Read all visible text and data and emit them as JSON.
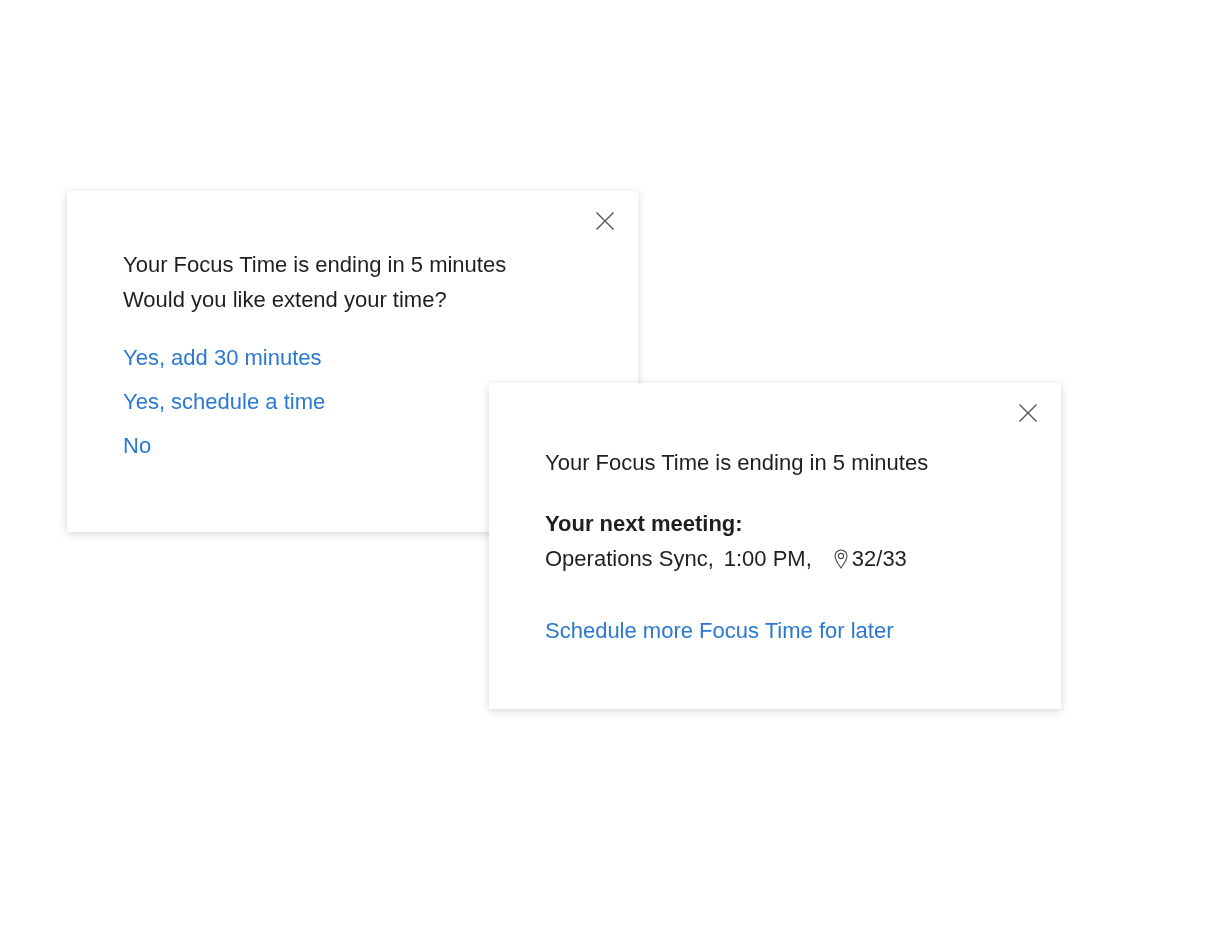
{
  "extend_prompt": {
    "message_lines": [
      "Your Focus Time is ending in 5 minutes",
      "Would you like extend your time?"
    ],
    "actions": [
      "Yes, add 30 minutes",
      "Yes, schedule a time",
      "No"
    ]
  },
  "meeting_prompt": {
    "message": "Your Focus Time is ending in 5 minutes",
    "next_meeting": {
      "heading": "Your next meeting:",
      "title": "Operations Sync,",
      "time": "1:00 PM,",
      "location": "32/33"
    },
    "actions": [
      "Schedule more Focus Time for later"
    ]
  }
}
